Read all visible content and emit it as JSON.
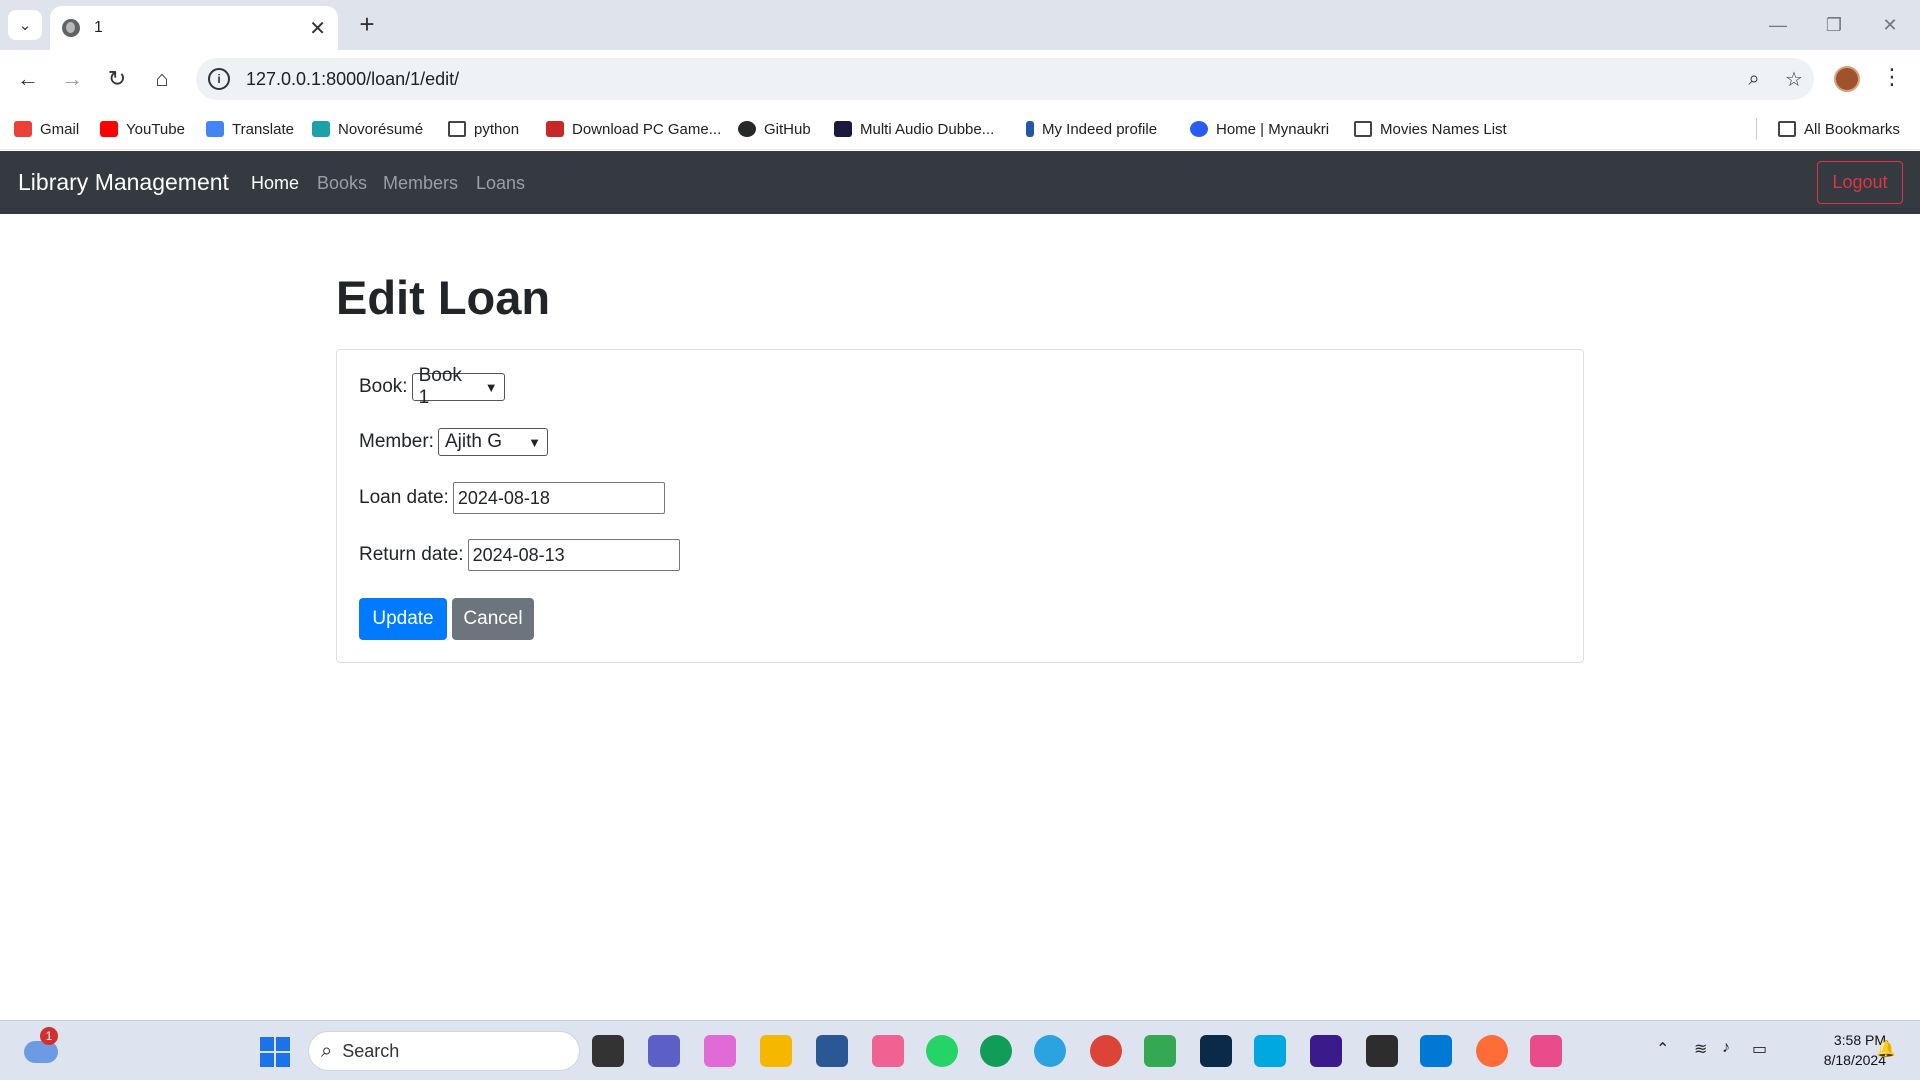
{
  "browser": {
    "tab_title": "1",
    "url": "127.0.0.1:8000/loan/1/edit/",
    "bookmarks": [
      {
        "label": "Gmail",
        "color": "#ea4335"
      },
      {
        "label": "YouTube",
        "color": "#ff0000"
      },
      {
        "label": "Translate",
        "color": "#4285f4"
      },
      {
        "label": "Novorésumé",
        "color": "#1aa1a9"
      },
      {
        "label": "python",
        "folder": true
      },
      {
        "label": "Download PC Game...",
        "color": "#c62828"
      },
      {
        "label": "GitHub",
        "color": "#24292e"
      },
      {
        "label": "Multi Audio Dubbe...",
        "color": "#1a1a40"
      },
      {
        "label": "My Indeed profile",
        "color": "#2557a7"
      },
      {
        "label": "Home | Mynaukri",
        "color": "#275df5"
      },
      {
        "label": "Movies Names List",
        "folder": true
      }
    ],
    "all_bookmarks": "All Bookmarks"
  },
  "app": {
    "brand": "Library Management",
    "nav": [
      "Home",
      "Books",
      "Members",
      "Loans"
    ],
    "logout": "Logout"
  },
  "form": {
    "title": "Edit Loan",
    "book_label": "Book:",
    "book_value": "Book 1",
    "member_label": "Member:",
    "member_value": "Ajith G",
    "loan_date_label": "Loan date:",
    "loan_date_value": "2024-08-18",
    "return_date_label": "Return date:",
    "return_date_value": "2024-08-13",
    "update": "Update",
    "cancel": "Cancel"
  },
  "taskbar": {
    "weather_badge": "1",
    "search": "Search",
    "time": "3:58 PM",
    "date": "8/18/2024"
  }
}
